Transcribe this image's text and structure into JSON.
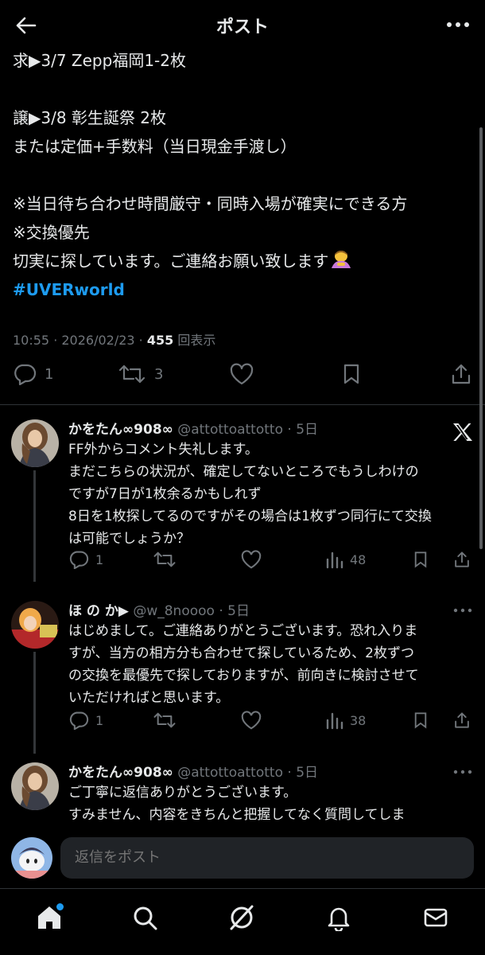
{
  "header": {
    "title": "ポスト"
  },
  "post": {
    "lines": [
      "求▶3/7 Zepp福岡1-2枚",
      "",
      "譲▶3/8 彰生誕祭 2枚",
      "または定価+手数料（当日現金手渡し）",
      "",
      "※当日待ち合わせ時間厳守・同時入場が確実にできる方",
      "※交換優先",
      "切実に探しています。ご連絡お願い致します"
    ],
    "hashtag": "#UVERworld",
    "time": "10:55 · 2026/02/23 · ",
    "views": "455",
    "views_label": " 回表示",
    "reply_count": "1",
    "repost_count": "3"
  },
  "replies": [
    {
      "name": "かをたん∞908∞",
      "handle": " @attottoattotto · 5日",
      "lines": [
        "FF外からコメント失礼します。",
        "まだこちらの状況が、確定してないところでもうしわけの",
        "ですが7日が1枚余るかもしれず",
        "8日を1枚探してるのですがその場合は1枚ずつ同行にて交換",
        "は可能でしょうか？"
      ],
      "reply_count": "1",
      "views": "48"
    },
    {
      "name": "ほ の か▶",
      "handle": " @w_8noooo · 5日",
      "lines": [
        "はじめまして。ご連絡ありがとうございます。恐れ入りま",
        "すが、当方の相方分も合わせて探しているため、2枚ずつ",
        "の交換を最優先で探しておりますが、前向きに検討させて",
        "いただければと思います。"
      ],
      "reply_count": "1",
      "views": "38"
    },
    {
      "name": "かをたん∞908∞",
      "handle": " @attottoattotto · 5日",
      "lines": [
        "ご丁寧に返信ありがとうございます。",
        "すみません、内容をきちんと把握してなく質問してしま"
      ]
    }
  ],
  "compose": {
    "placeholder": "返信をポスト"
  },
  "colors": {
    "accent": "#1d9bf0",
    "muted": "#71767b",
    "text": "#e7e9ea"
  }
}
